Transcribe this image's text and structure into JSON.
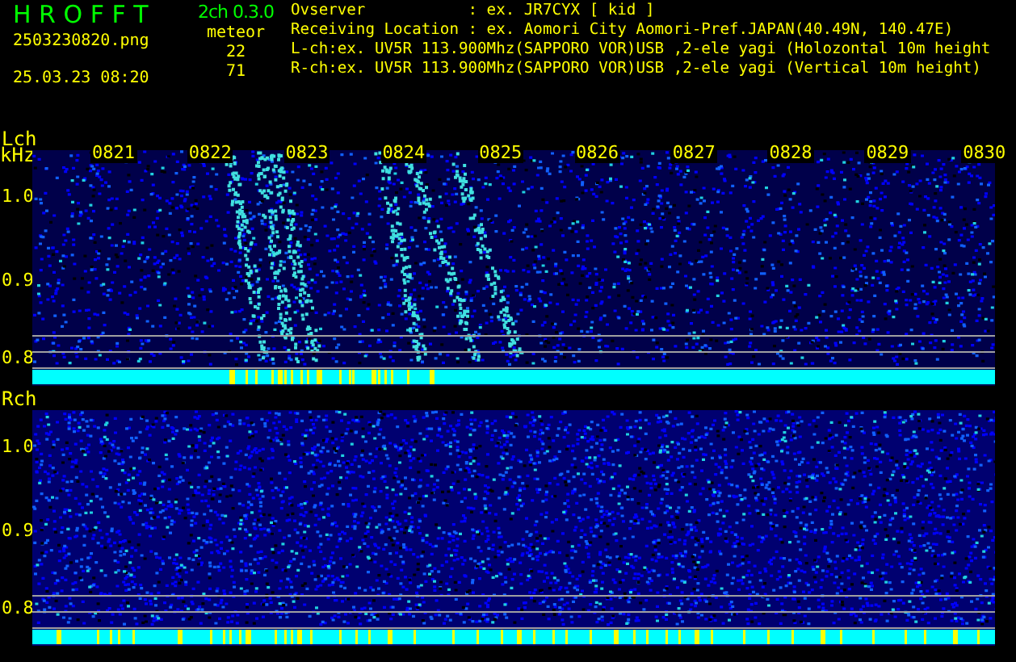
{
  "header": {
    "app_title": "H R O F F T",
    "version": "2ch 0.3.0",
    "filename": "2503230820.png",
    "datetime": "25.03.23 08:20",
    "meteor_label": "meteor",
    "meteor_counts": [
      "22",
      "71"
    ]
  },
  "info_lines": [
    {
      "label": "Ovserver",
      "value": ": ex. JR7CYX [ kid ]"
    },
    {
      "label": "Receiving Location",
      "value": ": ex. Aomori City Aomori-Pref.JAPAN(40.49N, 140.47E)"
    },
    {
      "label": "L-ch:ex. UV5R 113.900Mhz(SAPPORO VOR)USB ,2-ele yagi (Holozontal 10m height"
    },
    {
      "label": "R-ch:ex. UV5R 113.900Mhz(SAPPORO VOR)USB ,2-ele yagi (Vertical 10m height)"
    }
  ],
  "panels": [
    {
      "label": "Lch",
      "unit": "kHz",
      "meteors": true,
      "time_labels": [
        "0821",
        "0822",
        "0823",
        "0824",
        "0825",
        "0826",
        "0827",
        "0828",
        "0829",
        "0830"
      ],
      "freq_labels": [
        "1.0",
        "0.9",
        "0.8"
      ]
    },
    {
      "label": "Rch",
      "meteors": false,
      "freq_labels": [
        "1.0",
        "0.9",
        "0.8"
      ]
    }
  ]
}
